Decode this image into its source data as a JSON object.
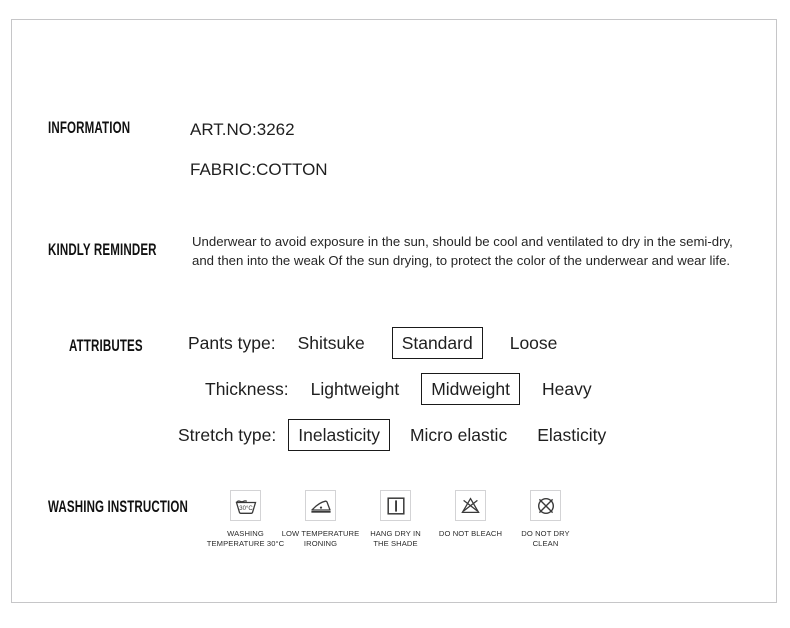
{
  "card": {
    "border_color": "#c6c6c8"
  },
  "information": {
    "heading": "INFORMATION",
    "art_no": "ART.NO:3262",
    "fabric": "FABRIC:COTTON"
  },
  "reminder": {
    "heading": "KINDLY REMINDER",
    "line1": "Underwear to avoid exposure in the sun, should be cool and ventilated to dry in the semi-dry,",
    "line2": "and then into the weak Of the sun drying, to protect the color of the underwear and wear life."
  },
  "attributes": {
    "heading": "ATTRIBUTES",
    "rows": [
      {
        "label": "Pants type:",
        "options": [
          {
            "text": "Shitsuke",
            "selected": false
          },
          {
            "text": "Standard",
            "selected": true
          },
          {
            "text": "Loose",
            "selected": false
          }
        ]
      },
      {
        "label": "Thickness:",
        "options": [
          {
            "text": "Lightweight",
            "selected": false
          },
          {
            "text": "Midweight",
            "selected": true
          },
          {
            "text": "Heavy",
            "selected": false
          }
        ]
      },
      {
        "label": "Stretch type:",
        "options": [
          {
            "text": "Inelasticity",
            "selected": true
          },
          {
            "text": "Micro elastic",
            "selected": false
          },
          {
            "text": "Elasticity",
            "selected": false
          }
        ]
      }
    ]
  },
  "washing": {
    "heading": "WASHING INSTRUCTION",
    "icons": [
      {
        "icon": "wash-tub-30c-icon",
        "temperature": "30°C",
        "label_line1": "WASHING",
        "label_line2": "TEMPERATURE 30°C"
      },
      {
        "icon": "iron-low-temperature-icon",
        "label_line1": "LOW TEMPERATURE",
        "label_line2": "IRONING"
      },
      {
        "icon": "hang-dry-in-shade-icon",
        "label_line1": "HANG DRY IN",
        "label_line2": "THE SHADE"
      },
      {
        "icon": "do-not-bleach-icon",
        "label_line1": "DO NOT BLEACH",
        "label_line2": ""
      },
      {
        "icon": "do-not-dry-clean-icon",
        "label_line1": "DO NOT DRY",
        "label_line2": "CLEAN"
      }
    ]
  }
}
